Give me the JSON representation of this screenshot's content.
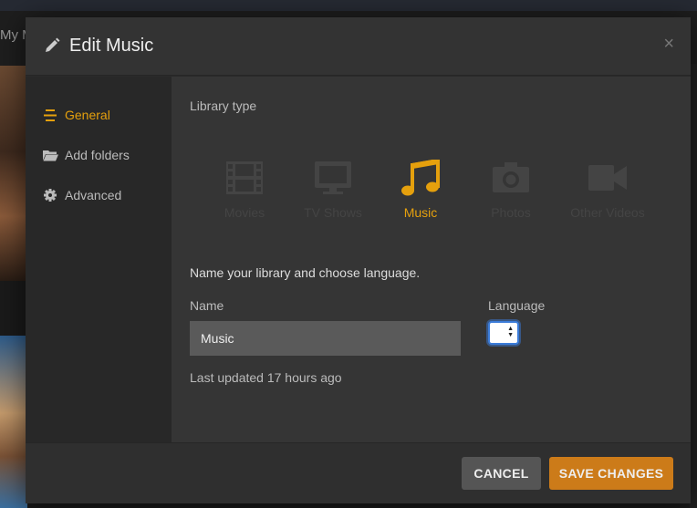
{
  "background": {
    "partial_title": "My M"
  },
  "modal": {
    "title": "Edit Music",
    "close_glyph": "×"
  },
  "sidebar": {
    "items": [
      {
        "label": "General",
        "icon": "list-icon",
        "active": true
      },
      {
        "label": "Add folders",
        "icon": "folder-icon",
        "active": false
      },
      {
        "label": "Advanced",
        "icon": "gear-icon",
        "active": false
      }
    ]
  },
  "content": {
    "library_type_label": "Library type",
    "types": [
      {
        "label": "Movies",
        "icon": "film-icon",
        "active": false
      },
      {
        "label": "TV Shows",
        "icon": "tv-icon",
        "active": false
      },
      {
        "label": "Music",
        "icon": "music-icon",
        "active": true
      },
      {
        "label": "Photos",
        "icon": "camera-icon",
        "active": false
      },
      {
        "label": "Other Videos",
        "icon": "video-camera-icon",
        "active": false
      }
    ],
    "intro": "Name your library and choose language.",
    "name_label": "Name",
    "name_value": "Music",
    "language_label": "Language",
    "language_value": "",
    "last_updated": "Last updated 17 hours ago"
  },
  "footer": {
    "cancel_label": "CANCEL",
    "save_label": "SAVE CHANGES"
  },
  "colors": {
    "accent": "#e5a00d",
    "save_button": "#cc7b19",
    "cancel_button": "#555555",
    "inactive_type": "#444444"
  }
}
